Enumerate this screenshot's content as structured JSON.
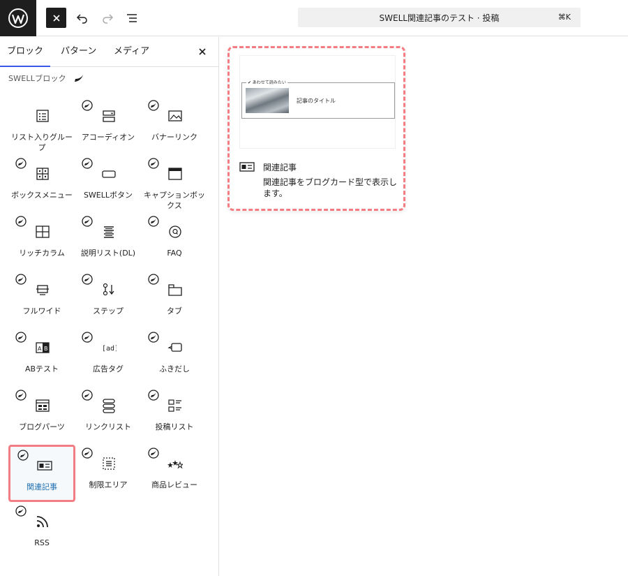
{
  "topbar": {
    "command_title": "SWELL関連記事のテスト · 投稿",
    "command_shortcut": "⌘K"
  },
  "tabs": [
    {
      "label": "ブロック",
      "active": true
    },
    {
      "label": "パターン",
      "active": false
    },
    {
      "label": "メディア",
      "active": false
    }
  ],
  "category": {
    "title": "SWELLブロック"
  },
  "blocks": [
    {
      "label": "リスト入りグループ",
      "icon": "list-group-icon",
      "badge": false,
      "selected": false
    },
    {
      "label": "アコーディオン",
      "icon": "accordion-icon",
      "badge": true,
      "selected": false
    },
    {
      "label": "バナーリンク",
      "icon": "banner-link-icon",
      "badge": true,
      "selected": false
    },
    {
      "label": "ボックスメニュー",
      "icon": "box-menu-icon",
      "badge": true,
      "selected": false
    },
    {
      "label": "SWELLボタン",
      "icon": "button-icon",
      "badge": true,
      "selected": false
    },
    {
      "label": "キャプションボックス",
      "icon": "caption-box-icon",
      "badge": true,
      "selected": false
    },
    {
      "label": "リッチカラム",
      "icon": "rich-columns-icon",
      "badge": true,
      "selected": false
    },
    {
      "label": "説明リスト(DL)",
      "icon": "description-list-icon",
      "badge": true,
      "selected": false
    },
    {
      "label": "FAQ",
      "icon": "faq-icon",
      "badge": true,
      "selected": false
    },
    {
      "label": "フルワイド",
      "icon": "full-wide-icon",
      "badge": true,
      "selected": false
    },
    {
      "label": "ステップ",
      "icon": "step-icon",
      "badge": true,
      "selected": false
    },
    {
      "label": "タブ",
      "icon": "tab-icon",
      "badge": true,
      "selected": false
    },
    {
      "label": "ABテスト",
      "icon": "ab-test-icon",
      "badge": true,
      "selected": false
    },
    {
      "label": "広告タグ",
      "icon": "ad-tag-icon",
      "badge": true,
      "selected": false
    },
    {
      "label": "ふきだし",
      "icon": "balloon-icon",
      "badge": true,
      "selected": false
    },
    {
      "label": "ブログパーツ",
      "icon": "blog-parts-icon",
      "badge": true,
      "selected": false
    },
    {
      "label": "リンクリスト",
      "icon": "link-list-icon",
      "badge": true,
      "selected": false
    },
    {
      "label": "投稿リスト",
      "icon": "post-list-icon",
      "badge": true,
      "selected": false
    },
    {
      "label": "関連記事",
      "icon": "related-post-icon",
      "badge": true,
      "selected": true
    },
    {
      "label": "制限エリア",
      "icon": "restricted-area-icon",
      "badge": true,
      "selected": false
    },
    {
      "label": "商品レビュー",
      "icon": "product-review-icon",
      "badge": true,
      "selected": false
    },
    {
      "label": "RSS",
      "icon": "rss-icon",
      "badge": true,
      "selected": false
    }
  ],
  "preview": {
    "card_caption": "✔ あわせて読みたい",
    "card_title": "記事のタイトル",
    "name": "関連記事",
    "description": "関連記事をブログカード型で表示します。"
  },
  "colors": {
    "highlight": "#f47d84",
    "selected_label": "#2271b1",
    "tab_active": "#3858e9",
    "dark": "#1e1e1e"
  }
}
